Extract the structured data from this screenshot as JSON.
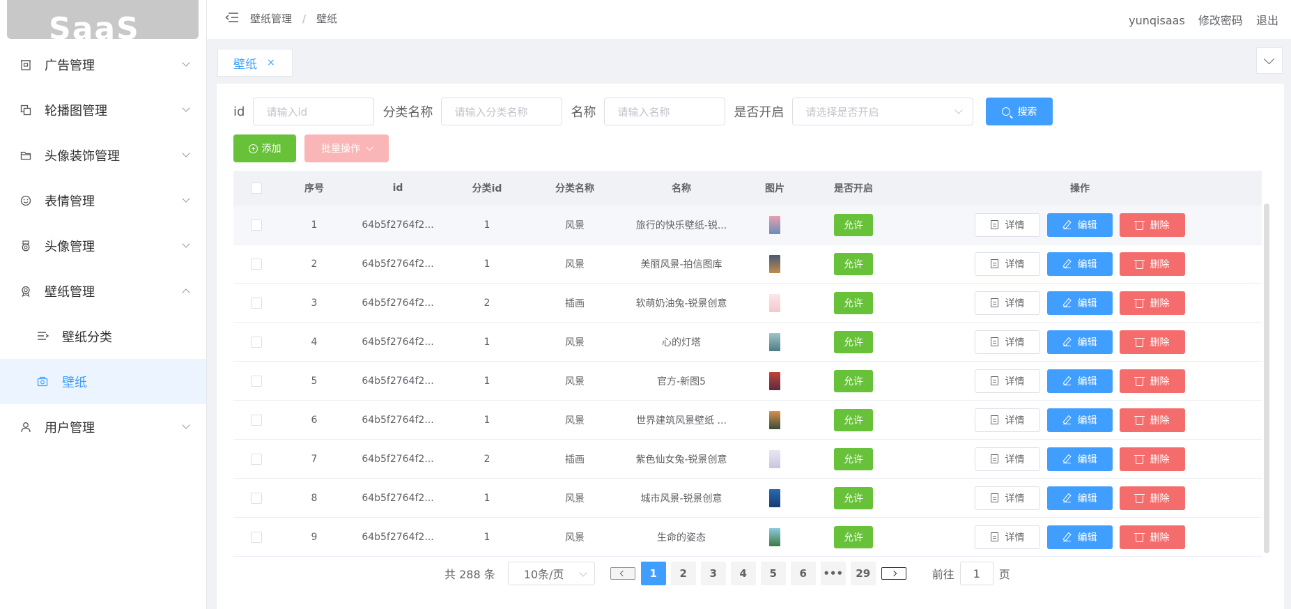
{
  "header": {
    "breadcrumb": [
      "壁纸管理",
      "壁纸"
    ],
    "user": "yunqisaas",
    "change_password": "修改密码",
    "logout": "退出"
  },
  "logo_text": "SaaS",
  "sidebar": {
    "items": [
      {
        "label": "广告管理",
        "icon": "ad-icon",
        "expanded": false
      },
      {
        "label": "轮播图管理",
        "icon": "carousel-icon",
        "expanded": false
      },
      {
        "label": "头像装饰管理",
        "icon": "folder-icon",
        "expanded": false
      },
      {
        "label": "表情管理",
        "icon": "smile-icon",
        "expanded": false
      },
      {
        "label": "头像管理",
        "icon": "medal-icon",
        "expanded": false
      },
      {
        "label": "壁纸管理",
        "icon": "award-icon",
        "expanded": true
      },
      {
        "label": "用户管理",
        "icon": "user-icon",
        "expanded": false
      }
    ],
    "sub_items": [
      {
        "label": "壁纸分类",
        "icon": "list-indent-icon",
        "active": false
      },
      {
        "label": "壁纸",
        "icon": "camera-bag-icon",
        "active": true
      }
    ]
  },
  "tabs": [
    {
      "label": "壁纸",
      "close": "×"
    }
  ],
  "filter": {
    "id_label": "id",
    "id_placeholder": "请输入id",
    "category_label": "分类名称",
    "category_placeholder": "请输入分类名称",
    "name_label": "名称",
    "name_placeholder": "请输入名称",
    "open_label": "是否开启",
    "open_placeholder": "请选择是否开启",
    "search_button": "搜索"
  },
  "actions": {
    "add": "添加",
    "batch": "批量操作"
  },
  "table": {
    "columns": [
      "序号",
      "id",
      "分类id",
      "分类名称",
      "名称",
      "图片",
      "是否开启",
      "操作"
    ],
    "rows": [
      {
        "seq": "1",
        "id": "64b5f2764f2...",
        "cid": "1",
        "cname": "风景",
        "name": "旅行的快乐壁纸-锐...",
        "open": "允许",
        "thumb": [
          "#e8a0b0",
          "#6a8db8"
        ]
      },
      {
        "seq": "2",
        "id": "64b5f2764f2...",
        "cid": "1",
        "cname": "风景",
        "name": "美丽风景-拍信图库",
        "open": "允许",
        "thumb": [
          "#4a5a70",
          "#c08a50"
        ]
      },
      {
        "seq": "3",
        "id": "64b5f2764f2...",
        "cid": "2",
        "cname": "插画",
        "name": "软萌奶油兔-锐景创意",
        "open": "允许",
        "thumb": [
          "#fbe8ea",
          "#f4c6cc"
        ]
      },
      {
        "seq": "4",
        "id": "64b5f2764f2...",
        "cid": "1",
        "cname": "风景",
        "name": "心的灯塔",
        "open": "允许",
        "thumb": [
          "#9fc4c8",
          "#4d7c86"
        ]
      },
      {
        "seq": "5",
        "id": "64b5f2764f2...",
        "cid": "1",
        "cname": "风景",
        "name": "官方-新图5",
        "open": "允许",
        "thumb": [
          "#c0453a",
          "#5a2a40"
        ]
      },
      {
        "seq": "6",
        "id": "64b5f2764f2...",
        "cid": "1",
        "cname": "风景",
        "name": "世界建筑风景壁纸 ...",
        "open": "允许",
        "thumb": [
          "#d8914a",
          "#3a4a3a"
        ]
      },
      {
        "seq": "7",
        "id": "64b5f2764f2...",
        "cid": "2",
        "cname": "插画",
        "name": "紫色仙女兔-锐景创意",
        "open": "允许",
        "thumb": [
          "#e8e6f4",
          "#c8c6e0"
        ]
      },
      {
        "seq": "8",
        "id": "64b5f2764f2...",
        "cid": "1",
        "cname": "风景",
        "name": "城市风景-锐景创意",
        "open": "允许",
        "thumb": [
          "#2a6ab0",
          "#183a70"
        ]
      },
      {
        "seq": "9",
        "id": "64b5f2764f2...",
        "cid": "1",
        "cname": "风景",
        "name": "生命的姿态",
        "open": "允许",
        "thumb": [
          "#8ec8e0",
          "#3a7a40"
        ]
      }
    ],
    "ops": {
      "detail": "详情",
      "edit": "编辑",
      "delete": "删除"
    }
  },
  "pagination": {
    "total": "共 288 条",
    "page_size": "10条/页",
    "pages": [
      "1",
      "2",
      "3",
      "4",
      "5",
      "6",
      "•••",
      "29"
    ],
    "current": "1",
    "goto_prefix": "前往",
    "goto_value": "1",
    "goto_suffix": "页"
  }
}
